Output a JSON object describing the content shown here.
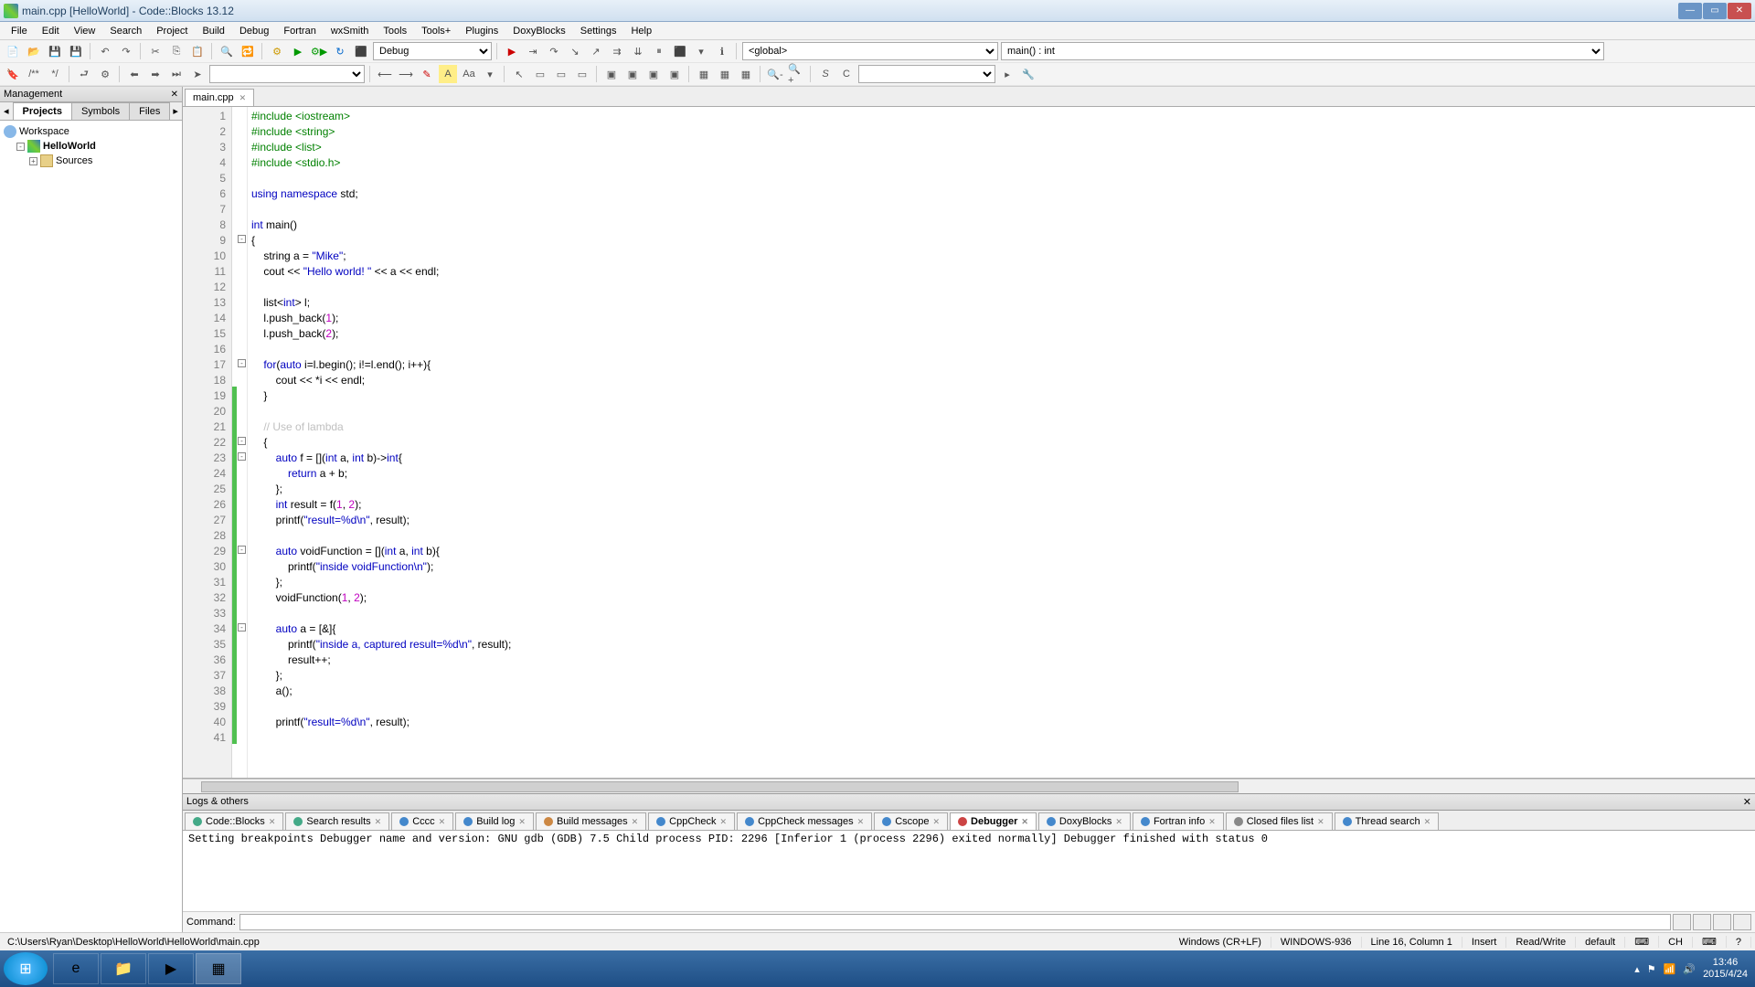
{
  "window": {
    "title": "main.cpp [HelloWorld] - Code::Blocks 13.12"
  },
  "menu": [
    "File",
    "Edit",
    "View",
    "Search",
    "Project",
    "Build",
    "Debug",
    "Fortran",
    "wxSmith",
    "Tools",
    "Tools+",
    "Plugins",
    "DoxyBlocks",
    "Settings",
    "Help"
  ],
  "toolbar": {
    "build_target": "Debug",
    "scope_select": "<global>",
    "func_select": "main() : int"
  },
  "management": {
    "title": "Management",
    "tabs": [
      "Projects",
      "Symbols",
      "Files"
    ],
    "active_tab": 0,
    "tree": {
      "workspace": "Workspace",
      "project": "HelloWorld",
      "sources": "Sources"
    }
  },
  "editor": {
    "tab": "main.cpp",
    "lines": [
      {
        "n": 1,
        "html": "<span class='pp'>#include &lt;iostream&gt;</span>"
      },
      {
        "n": 2,
        "html": "<span class='pp'>#include &lt;string&gt;</span>"
      },
      {
        "n": 3,
        "html": "<span class='pp'>#include &lt;list&gt;</span>"
      },
      {
        "n": 4,
        "html": "<span class='pp'>#include &lt;stdio.h&gt;</span>"
      },
      {
        "n": 5,
        "html": ""
      },
      {
        "n": 6,
        "html": "<span class='kw'>using namespace</span> std;"
      },
      {
        "n": 7,
        "html": ""
      },
      {
        "n": 8,
        "html": "<span class='kw'>int</span> main()"
      },
      {
        "n": 9,
        "html": "{",
        "fold": "-"
      },
      {
        "n": 10,
        "html": "    string a = <span class='str'>\"Mike\"</span>;"
      },
      {
        "n": 11,
        "html": "    cout &lt;&lt; <span class='str'>\"Hello world! \"</span> &lt;&lt; a &lt;&lt; endl;"
      },
      {
        "n": 12,
        "html": ""
      },
      {
        "n": 13,
        "html": "    list&lt;<span class='kw'>int</span>&gt; l;"
      },
      {
        "n": 14,
        "html": "    l.push_back(<span class='num'>1</span>);"
      },
      {
        "n": 15,
        "html": "    l.push_back(<span class='num'>2</span>);"
      },
      {
        "n": 16,
        "html": ""
      },
      {
        "n": 17,
        "html": "    <span class='kw'>for</span>(<span class='kw'>auto</span> i=l.begin(); i!=l.end(); i++){",
        "fold": "-"
      },
      {
        "n": 18,
        "html": "        cout &lt;&lt; *i &lt;&lt; endl;"
      },
      {
        "n": 19,
        "html": "    }",
        "chg": true
      },
      {
        "n": 20,
        "html": "",
        "chg": true
      },
      {
        "n": 21,
        "html": "    <span class='cmt'>// Use of lambda</span>",
        "chg": true
      },
      {
        "n": 22,
        "html": "    {",
        "fold": "-",
        "chg": true
      },
      {
        "n": 23,
        "html": "        <span class='kw'>auto</span> f = [](<span class='kw'>int</span> a, <span class='kw'>int</span> b)-&gt;<span class='kw'>int</span>{",
        "fold": "-",
        "chg": true
      },
      {
        "n": 24,
        "html": "            <span class='kw'>return</span> a + b;",
        "chg": true
      },
      {
        "n": 25,
        "html": "        };",
        "chg": true
      },
      {
        "n": 26,
        "html": "        <span class='kw'>int</span> result = f(<span class='num'>1</span>, <span class='num'>2</span>);",
        "chg": true
      },
      {
        "n": 27,
        "html": "        printf(<span class='str'>\"result=%d\\n\"</span>, result);",
        "chg": true
      },
      {
        "n": 28,
        "html": "",
        "chg": true
      },
      {
        "n": 29,
        "html": "        <span class='kw'>auto</span> voidFunction = [](<span class='kw'>int</span> a, <span class='kw'>int</span> b){",
        "fold": "-",
        "chg": true
      },
      {
        "n": 30,
        "html": "            printf(<span class='str'>\"inside voidFunction\\n\"</span>);",
        "chg": true
      },
      {
        "n": 31,
        "html": "        };",
        "chg": true
      },
      {
        "n": 32,
        "html": "        voidFunction(<span class='num'>1</span>, <span class='num'>2</span>);",
        "chg": true
      },
      {
        "n": 33,
        "html": "",
        "chg": true
      },
      {
        "n": 34,
        "html": "        <span class='kw'>auto</span> a = [&amp;]{",
        "fold": "-",
        "chg": true
      },
      {
        "n": 35,
        "html": "            printf(<span class='str'>\"inside a, captured result=%d\\n\"</span>, result);",
        "chg": true
      },
      {
        "n": 36,
        "html": "            result++;",
        "chg": true
      },
      {
        "n": 37,
        "html": "        };",
        "chg": true
      },
      {
        "n": 38,
        "html": "        a();",
        "chg": true
      },
      {
        "n": 39,
        "html": "",
        "chg": true
      },
      {
        "n": 40,
        "html": "        printf(<span class='str'>\"result=%d\\n\"</span>, result);",
        "chg": true
      },
      {
        "n": 41,
        "html": "",
        "chg": true
      }
    ]
  },
  "logs": {
    "title": "Logs & others",
    "tabs": [
      "Code::Blocks",
      "Search results",
      "Cccc",
      "Build log",
      "Build messages",
      "CppCheck",
      "CppCheck messages",
      "Cscope",
      "Debugger",
      "DoxyBlocks",
      "Fortran info",
      "Closed files list",
      "Thread search"
    ],
    "active": 8,
    "body": "Setting breakpoints\nDebugger name and version: GNU gdb (GDB) 7.5\nChild process PID: 2296\n[Inferior 1 (process 2296) exited normally]\nDebugger finished with status 0",
    "command_label": "Command:"
  },
  "status": {
    "path": "C:\\Users\\Ryan\\Desktop\\HelloWorld\\HelloWorld\\main.cpp",
    "eol": "Windows (CR+LF)",
    "enc": "WINDOWS-936",
    "pos": "Line 16, Column 1",
    "ins": "Insert",
    "rw": "Read/Write",
    "prof": "default"
  },
  "tray": {
    "time": "13:46",
    "date": "2015/4/24"
  }
}
